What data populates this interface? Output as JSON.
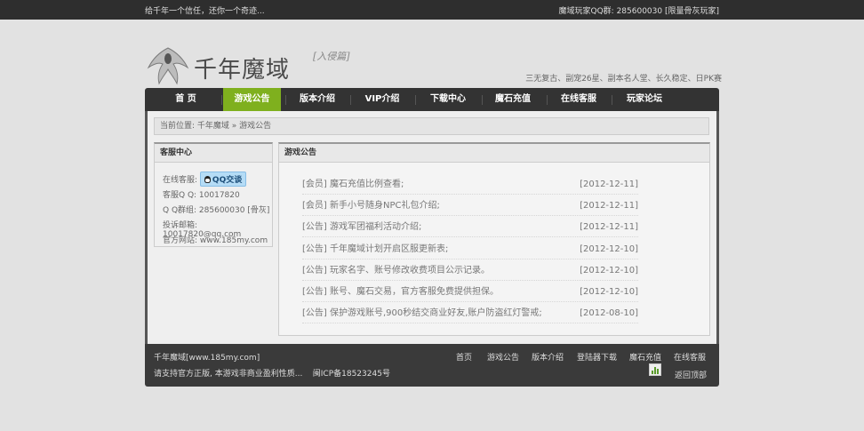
{
  "topbar": {
    "left": "给千年一个信任，还你一个奇迹...",
    "right": "魔域玩家QQ群: 285600030 [限量骨灰玩家]"
  },
  "logo": {
    "title": "千年魔域",
    "subtitle": "[入侵篇]"
  },
  "slogan": "三无复古、副宠26星、副本名人堂、长久稳定、日PK赛",
  "nav": [
    {
      "label": "首  页"
    },
    {
      "label": "游戏公告"
    },
    {
      "label": "版本介绍"
    },
    {
      "label": "VIP介绍"
    },
    {
      "label": "下载中心"
    },
    {
      "label": "魔石充值"
    },
    {
      "label": "在线客服"
    },
    {
      "label": "玩家论坛"
    }
  ],
  "breadcrumb": "当前位置: 千年魔域 » 游戏公告",
  "sidebar": {
    "title": "客服中心",
    "online_label": "在线客服:",
    "qq_button": "QQ交谈",
    "rows": [
      "客服Q Q: 10017820",
      "Q Q群组: 285600030 [骨灰]",
      "投诉邮箱: 10017820@qq.com",
      "官方网站: www.185my.com"
    ]
  },
  "main": {
    "title": "游戏公告",
    "news": [
      {
        "title": "[会员] 魔石充值比例查看;",
        "date": "[2012-12-11]"
      },
      {
        "title": "[会员] 新手小号随身NPC礼包介绍;",
        "date": "[2012-12-11]"
      },
      {
        "title": "[公告] 游戏军团福利活动介绍;",
        "date": "[2012-12-11]"
      },
      {
        "title": "[公告] 千年魔域计划开启区服更新表;",
        "date": "[2012-12-10]"
      },
      {
        "title": "[公告] 玩家名字、账号修改收费项目公示记录。",
        "date": "[2012-12-10]"
      },
      {
        "title": "[公告] 账号、魔石交易，官方客服免费提供担保。",
        "date": "[2012-12-10]"
      },
      {
        "title": "[公告] 保护游戏账号,900秒结交商业好友,账户防盗红灯警戒;",
        "date": "[2012-08-10]"
      }
    ]
  },
  "footer": {
    "site": "千年魔域[www.185my.com]",
    "notice": "请支持官方正版, 本游戏非商业盈利性质...",
    "icp": "闽ICP备18523245号",
    "links": [
      {
        "label": "首页"
      },
      {
        "label": "游戏公告"
      },
      {
        "label": "版本介绍"
      },
      {
        "label": "登陆器下载"
      },
      {
        "label": "魔石充值"
      },
      {
        "label": "在线客服"
      }
    ],
    "back_to_top": "返回顶部"
  }
}
